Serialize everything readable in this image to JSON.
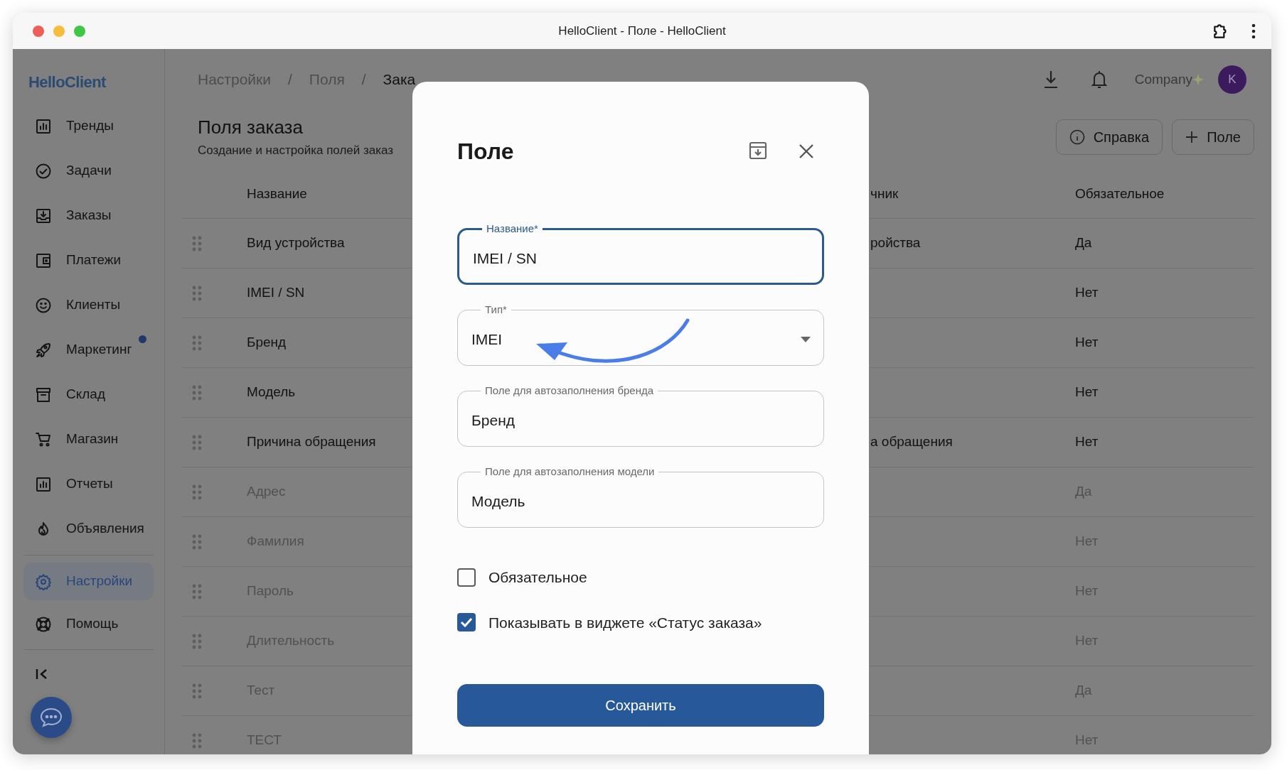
{
  "window": {
    "title": "HelloClient - Поле - HelloClient"
  },
  "sidebar": {
    "logo": "HelloClient",
    "items": [
      {
        "label": "Тренды",
        "selected": false,
        "notification": false
      },
      {
        "label": "Задачи",
        "selected": false,
        "notification": false
      },
      {
        "label": "Заказы",
        "selected": false,
        "notification": false
      },
      {
        "label": "Платежи",
        "selected": false,
        "notification": false
      },
      {
        "label": "Клиенты",
        "selected": false,
        "notification": false
      },
      {
        "label": "Маркетинг",
        "selected": false,
        "notification": true
      },
      {
        "label": "Склад",
        "selected": false,
        "notification": false
      },
      {
        "label": "Магазин",
        "selected": false,
        "notification": false
      },
      {
        "label": "Отчеты",
        "selected": false,
        "notification": false
      },
      {
        "label": "Объявления",
        "selected": false,
        "notification": false
      }
    ],
    "bottom_items": [
      {
        "label": "Настройки",
        "selected": true,
        "notification": false
      },
      {
        "label": "Помощь",
        "selected": false,
        "notification": false
      }
    ]
  },
  "breadcrumb": {
    "separator": "/",
    "items": [
      {
        "label": "Настройки",
        "current": false
      },
      {
        "label": "Поля",
        "current": false
      },
      {
        "label": "Зака",
        "current": true
      }
    ]
  },
  "header": {
    "company": "Company",
    "avatar": "K"
  },
  "page": {
    "title": "Поля заказа",
    "subtitle": "Создание и настройка полей заказ",
    "buttons": [
      "Справка",
      "Поле"
    ]
  },
  "table": {
    "columns": [
      "Название",
      "чник",
      "Обязательное"
    ],
    "rows": [
      {
        "name": "Вид устройства",
        "column_2": "ройства",
        "required": "Да",
        "dimmed": false
      },
      {
        "name": "IMEI / SN",
        "required": "Нет",
        "dimmed": false
      },
      {
        "name": "Бренд",
        "required": "Нет",
        "dimmed": false
      },
      {
        "name": "Модель",
        "required": "Нет",
        "dimmed": false
      },
      {
        "name": "Причина обращения",
        "column_2": "а обращения",
        "required": "Нет",
        "dimmed": false
      },
      {
        "name": "Адрес",
        "required": "Да",
        "dimmed": true
      },
      {
        "name": "Фамилия",
        "required": "Нет",
        "dimmed": true
      },
      {
        "name": "Пароль",
        "required": "Нет",
        "dimmed": true
      },
      {
        "name": "Длительность",
        "required": "Нет",
        "dimmed": true
      },
      {
        "name": "Тест",
        "required": "Да",
        "dimmed": true
      },
      {
        "name": "ТЕСТ",
        "required": "Нет",
        "dimmed": true
      }
    ]
  },
  "modal": {
    "title": "Поле",
    "fields": [
      {
        "kind": "text",
        "label": "Название*",
        "value": "IMEI / SN",
        "focused": true
      },
      {
        "kind": "select",
        "label": "Тип*",
        "value": "IMEI",
        "focused": false
      },
      {
        "kind": "text",
        "label": "Поле для автозаполнения бренда",
        "value": "Бренд",
        "focused": false
      },
      {
        "kind": "text",
        "label": "Поле для автозаполнения модели",
        "value": "Модель",
        "focused": false
      }
    ],
    "checkboxes": [
      {
        "label": "Обязательное",
        "checked": false
      },
      {
        "label": "Показывать в виджете «Статус заказа»",
        "checked": true
      }
    ],
    "save": "Сохранить"
  }
}
